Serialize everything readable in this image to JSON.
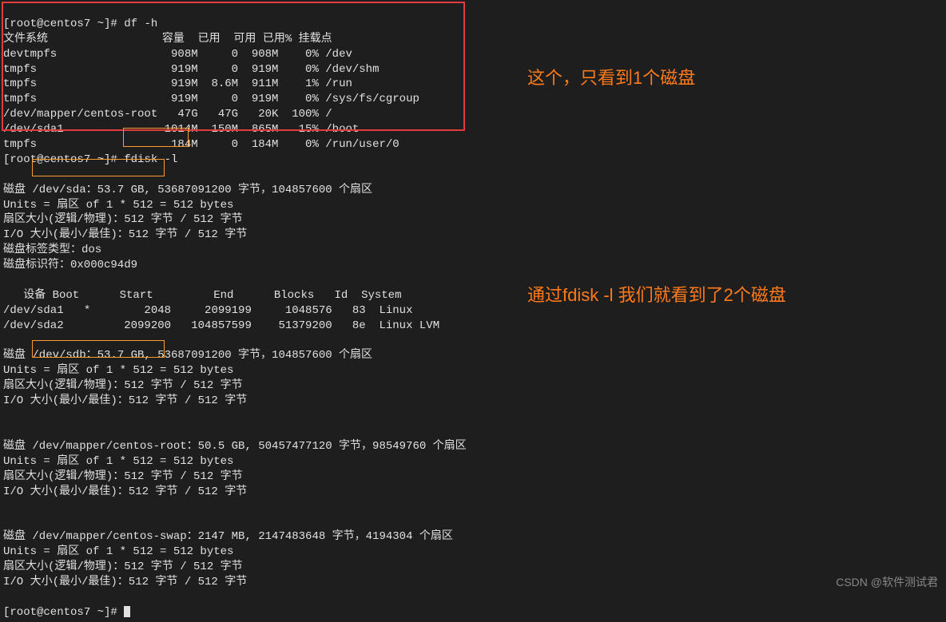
{
  "prompt1": "[root@centos7 ~]# ",
  "cmd1": "df -h",
  "df_header": "文件系统                 容量  已用  可用 已用% 挂载点",
  "df_rows": [
    "devtmpfs                 908M     0  908M    0% /dev",
    "tmpfs                    919M     0  919M    0% /dev/shm",
    "tmpfs                    919M  8.6M  911M    1% /run",
    "tmpfs                    919M     0  919M    0% /sys/fs/cgroup",
    "/dev/mapper/centos-root   47G   47G   20K  100% /",
    "/dev/sda1               1014M  150M  865M   15% /boot",
    "tmpfs                    184M     0  184M    0% /run/user/0"
  ],
  "prompt2": "[root@centos7 ~]# ",
  "cmd2": "fdisk -l",
  "blank": "",
  "sda_line": "磁盘 /dev/sda：53.7 GB, 53687091200 字节，104857600 个扇区",
  "units": "Units = 扇区 of 1 * 512 = 512 bytes",
  "sector_size": "扇区大小(逻辑/物理)：512 字节 / 512 字节",
  "io_size": "I/O 大小(最小/最佳)：512 字节 / 512 字节",
  "label_type": "磁盘标签类型：dos",
  "disk_id": "磁盘标识符：0x000c94d9",
  "part_header": "   设备 Boot      Start         End      Blocks   Id  System",
  "part_rows": [
    "/dev/sda1   *        2048     2099199     1048576   83  Linux",
    "/dev/sda2         2099200   104857599    51379200   8e  Linux LVM"
  ],
  "sdb_line": "磁盘 /dev/sdb：53.7 GB, 53687091200 字节，104857600 个扇区",
  "mapper_root": "磁盘 /dev/mapper/centos-root：50.5 GB, 50457477120 字节，98549760 个扇区",
  "mapper_swap": "磁盘 /dev/mapper/centos-swap：2147 MB, 2147483648 字节，4194304 个扇区",
  "prompt3": "[root@centos7 ~]# ",
  "annotation1": "这个，只看到1个磁盘",
  "annotation2": "通过fdisk -l 我们就看到了2个磁盘",
  "watermark": "CSDN @软件测试君"
}
